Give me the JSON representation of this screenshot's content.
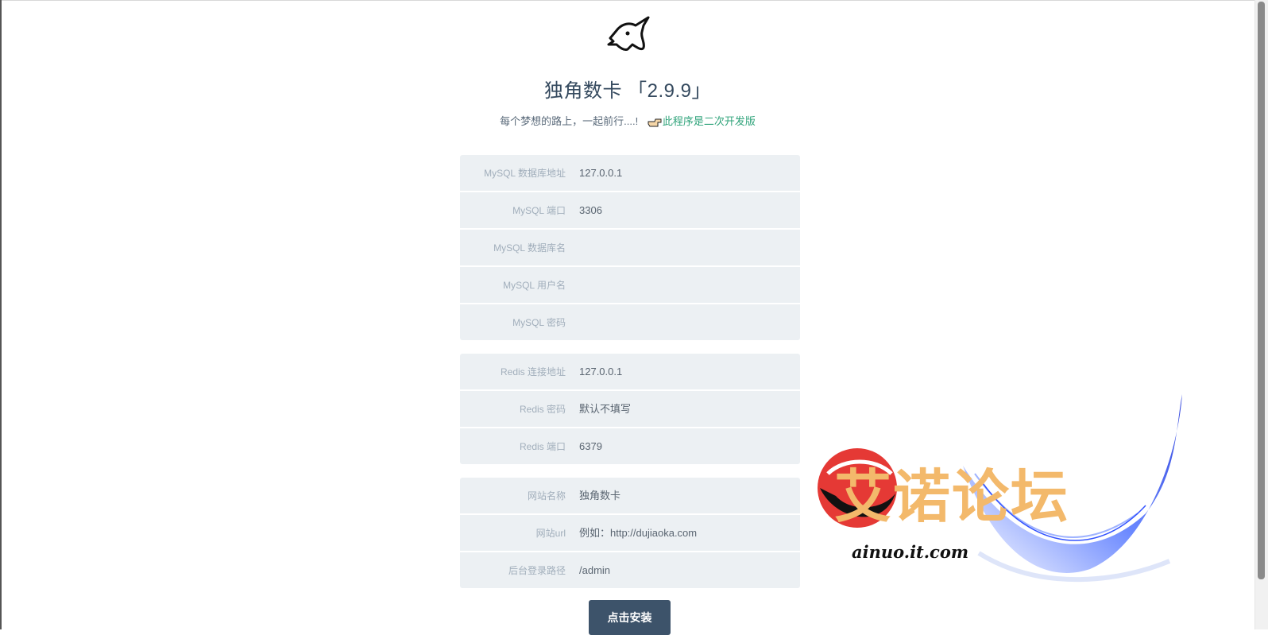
{
  "header": {
    "logo_icon": "unicorn-logo-icon",
    "title": "独角数卡 「2.9.9」",
    "subtitle_text": "每个梦想的路上，一起前行....!",
    "subtitle_link_icon": "pointing-hand-icon",
    "subtitle_link": "此程序是二次开发版"
  },
  "mysql": {
    "host": {
      "label": "MySQL 数据库地址",
      "value": "",
      "placeholder": "127.0.0.1"
    },
    "port": {
      "label": "MySQL 端口",
      "value": "",
      "placeholder": "3306"
    },
    "database": {
      "label": "MySQL 数据库名",
      "value": "",
      "placeholder": ""
    },
    "username": {
      "label": "MySQL 用户名",
      "value": "",
      "placeholder": ""
    },
    "password": {
      "label": "MySQL 密码",
      "value": "",
      "placeholder": ""
    }
  },
  "redis": {
    "host": {
      "label": "Redis 连接地址",
      "value": "",
      "placeholder": "127.0.0.1"
    },
    "password": {
      "label": "Redis 密码",
      "value": "",
      "placeholder": "默认不填写"
    },
    "port": {
      "label": "Redis 端口",
      "value": "",
      "placeholder": "6379"
    }
  },
  "site": {
    "name": {
      "label": "网站名称",
      "value": "",
      "placeholder": "独角数卡"
    },
    "url": {
      "label": "网站url",
      "value": "",
      "placeholder": "例如：http://dujiaoka.com"
    },
    "admin_path": {
      "label": "后台登录路径",
      "value": "",
      "placeholder": "/admin"
    }
  },
  "install_button": "点击安装",
  "watermark": {
    "text": "艾诺论坛",
    "url": "ainuo.it.com",
    "colors": {
      "orange": "#f3b96b",
      "red": "#e53935",
      "blue": "#1a3dff"
    }
  },
  "colors": {
    "field_bg": "#ecf0f3",
    "button_bg": "#3d536a",
    "link": "#2fa37a"
  }
}
